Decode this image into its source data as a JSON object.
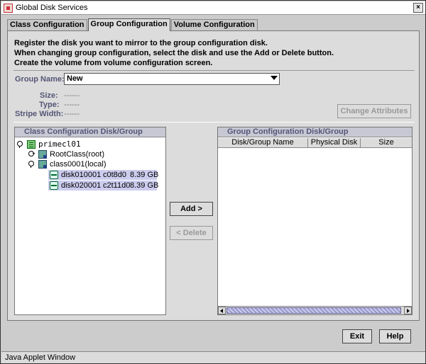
{
  "window": {
    "title": "Global Disk Services",
    "close_glyph": "×"
  },
  "tabs": [
    {
      "label": "Class Configuration",
      "active": false
    },
    {
      "label": "Group Configuration",
      "active": true
    },
    {
      "label": "Volume Configuration",
      "active": false
    }
  ],
  "info_lines": [
    "Register the disk you want to mirror to the group configuration disk.",
    "When changing group configuration, select the disk and use the Add or Delete button.",
    "Create the volume from volume configuration screen."
  ],
  "group": {
    "name_label": "Group Name:",
    "name_value": "New",
    "size_label": "Size:",
    "size_value": "------",
    "type_label": "Type:",
    "type_value": "------",
    "stripe_label": "Stripe Width:",
    "stripe_value": "------",
    "change_attributes_label": "Change Attributes"
  },
  "class_panel": {
    "header": "Class Configuration Disk/Group",
    "tree": {
      "root": "primecl01",
      "root_class": "RootClass(root)",
      "class": "class0001(local)",
      "disks": [
        {
          "name": "disk010001",
          "device": "c0t8d0",
          "size": "8.39 GB"
        },
        {
          "name": "disk020001",
          "device": "c2t11d0",
          "size": "8.39 GB"
        }
      ]
    }
  },
  "buttons": {
    "add": "Add >",
    "delete": "< Delete",
    "exit": "Exit",
    "help": "Help"
  },
  "group_panel": {
    "header": "Group Configuration Disk/Group",
    "columns": [
      "Disk/Group Name",
      "Physical Disk",
      "Size"
    ]
  },
  "status_bar": "Java Applet Window"
}
